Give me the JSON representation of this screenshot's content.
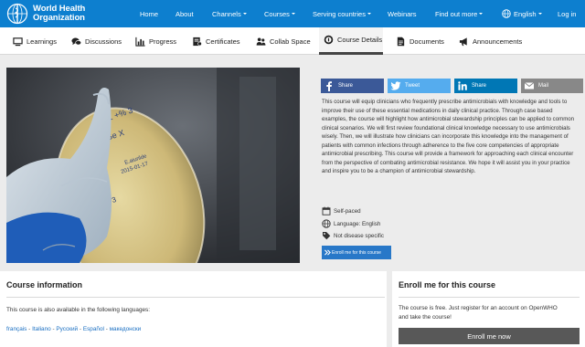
{
  "site": {
    "logo_line1": "World Health",
    "logo_line2": "Organization"
  },
  "topnav": {
    "home": "Home",
    "about": "About",
    "channels": "Channels",
    "courses": "Courses",
    "serving_countries": "Serving countries",
    "webinars": "Webinars",
    "find_out_more": "Find out more",
    "language": "English",
    "login": "Log in"
  },
  "subnav": {
    "learnings": "Learnings",
    "discussions": "Discussions",
    "progress": "Progress",
    "certificates": "Certificates",
    "collab_space": "Collab Space",
    "course_details": "Course Details",
    "documents": "Documents",
    "announcements": "Announcements"
  },
  "share": {
    "facebook": "Share",
    "twitter": "Tweet",
    "linkedin": "Share",
    "mail": "Mail"
  },
  "course": {
    "description": "This course will equip clinicians who frequently prescribe antimicrobials with knowledge and tools to improve their use of these essential medications in daily clinical practice. Through case based examples, the course will highlight how antimicrobial stewardship principles can be applied to common clinical scenarios. We will first review foundational clinical knowledge necessary to use antimicrobials wisely. Then, we will illustrate how clinicians can incorporate this knowledge into the management of patients with common infections through adherence to the five core competencies of appropriate antimicrobial prescribing. This course will provide a framework for approaching each clinical encounter from the perspective of combating antimicrobial resistance. We hope it will assist you in your practice and inspire you to be a champion of antimicrobial stewardship.",
    "pace": "Self-paced",
    "language": "Language: English",
    "disease": "Not disease specific",
    "enroll_small": "Enroll me for this course"
  },
  "course_info": {
    "title": "Course information",
    "available_text": "This course is also available in the following languages:",
    "languages": [
      "français",
      "Italiano",
      "Русский",
      "Español",
      "македонски"
    ],
    "separator": "-"
  },
  "enroll_box": {
    "title": "Enroll me for this course",
    "text_line1": "The course is free. Just register for an account on OpenWHO",
    "text_line2": "and take the course!",
    "button": "Enroll me now"
  },
  "colors": {
    "nav_blue": "#0d7fcf",
    "facebook": "#3b5998",
    "twitter": "#55acee",
    "linkedin": "#0077b5",
    "mail": "#888888",
    "enroll_blue": "#2878c8",
    "link_blue": "#1a6fc2",
    "enroll_dark": "#585858"
  },
  "icons": {
    "logo": "who-emblem-icon",
    "language": "globe-icon",
    "learnings": "screen-icon",
    "discussions": "chat-bubbles-icon",
    "progress": "bar-chart-icon",
    "certificates": "certificate-icon",
    "collab_space": "people-icon",
    "course_details": "info-circle-icon",
    "documents": "document-icon",
    "announcements": "megaphone-icon",
    "pace": "calendar-icon",
    "meta_language": "globe-icon",
    "disease": "tag-icon",
    "enroll": "double-chevron-icon"
  }
}
